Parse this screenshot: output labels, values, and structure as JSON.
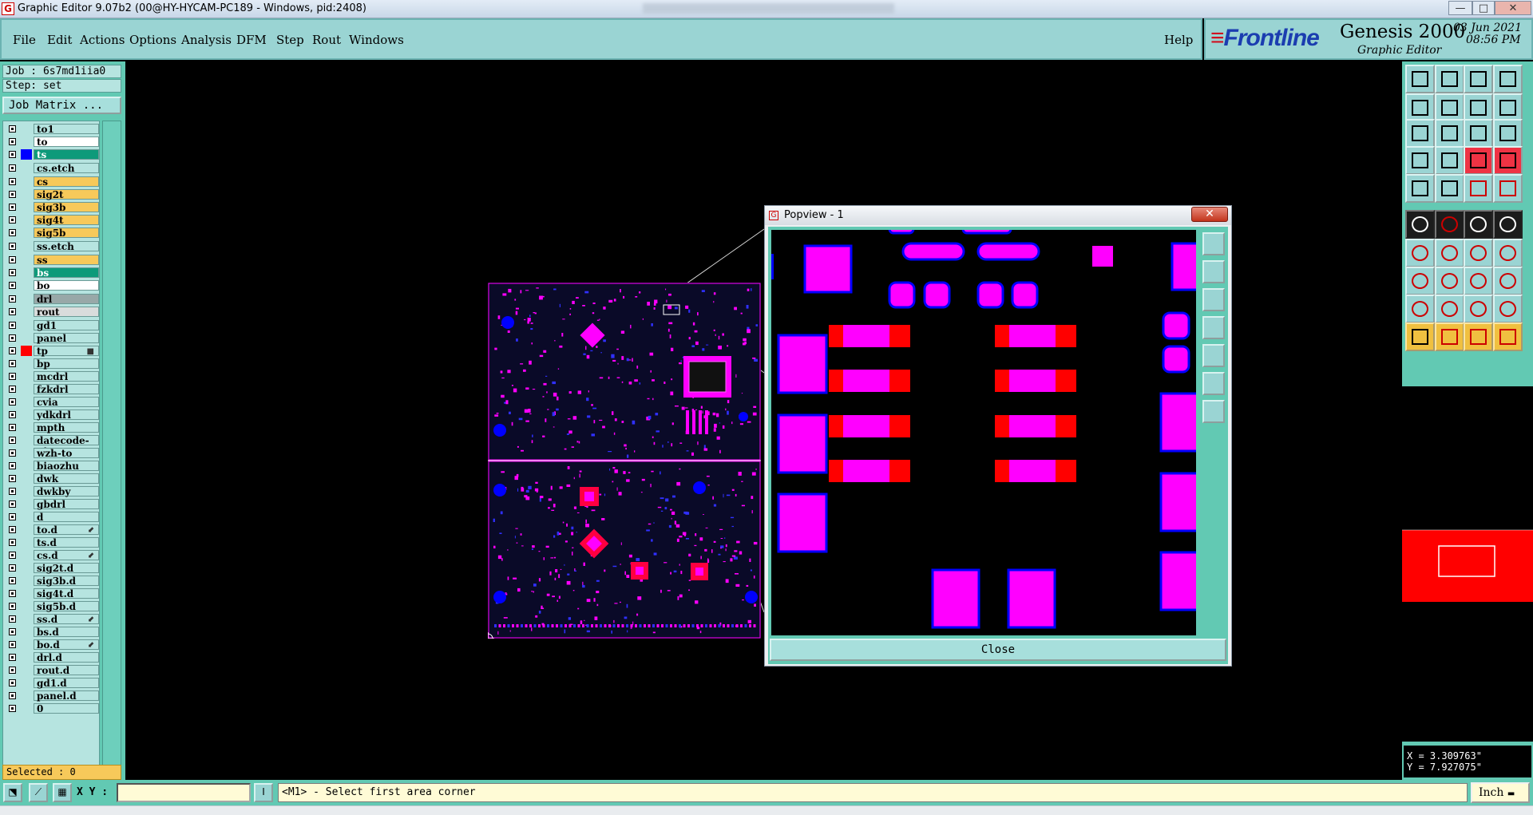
{
  "window": {
    "title": "Graphic Editor 9.07b2 (00@HY-HYCAM-PC189 - Windows, pid:2408)",
    "controls": {
      "minimize": "—",
      "maximize": "□",
      "close": "✕"
    }
  },
  "menu": {
    "items": [
      "File",
      "Edit",
      "Actions",
      "Options",
      "Analysis",
      "DFM",
      "Step",
      "Rout",
      "Windows"
    ],
    "help": "Help"
  },
  "brand": {
    "logo": "Frontline",
    "product": "Genesis 2000",
    "subtitle": "Graphic Editor",
    "date": "03 Jun 2021",
    "time": "08:56 PM"
  },
  "job": {
    "job_line": "Job : 6s7md1iia0",
    "step_line": "Step: set",
    "job_matrix": "Job Matrix ..."
  },
  "layers": [
    {
      "name": "to1",
      "swatch": "",
      "bg": "#b6e4e0"
    },
    {
      "name": "to",
      "swatch": "",
      "bg": "#ffffff"
    },
    {
      "name": "ts",
      "swatch": "#0000ff",
      "bg": "#0d9a7a"
    },
    {
      "name": "cs.etch",
      "swatch": "",
      "bg": "#b6e4e0"
    },
    {
      "name": "cs",
      "swatch": "",
      "bg": "#f7c95a"
    },
    {
      "name": "sig2t",
      "swatch": "",
      "bg": "#f7c95a"
    },
    {
      "name": "sig3b",
      "swatch": "",
      "bg": "#f7c95a"
    },
    {
      "name": "sig4t",
      "swatch": "",
      "bg": "#f7c95a"
    },
    {
      "name": "sig5b",
      "swatch": "",
      "bg": "#f7c95a"
    },
    {
      "name": "ss.etch",
      "swatch": "",
      "bg": "#b6e4e0"
    },
    {
      "name": "ss",
      "swatch": "",
      "bg": "#f7c95a"
    },
    {
      "name": "bs",
      "swatch": "",
      "bg": "#0d9a7a"
    },
    {
      "name": "bo",
      "swatch": "",
      "bg": "#ffffff"
    },
    {
      "name": "drl",
      "swatch": "",
      "bg": "#98a8a8"
    },
    {
      "name": "rout",
      "swatch": "",
      "bg": "#d9dcdc"
    },
    {
      "name": "gd1",
      "swatch": "",
      "bg": "#b6e4e0"
    },
    {
      "name": "panel",
      "swatch": "",
      "bg": "#b6e4e0"
    },
    {
      "name": "tp",
      "swatch": "#ff0000",
      "bg": "#b6e4e0",
      "mark": "■"
    },
    {
      "name": "bp",
      "swatch": "",
      "bg": "#b6e4e0"
    },
    {
      "name": "mcdrl",
      "swatch": "",
      "bg": "#b6e4e0"
    },
    {
      "name": "fzkdrl",
      "swatch": "",
      "bg": "#b6e4e0"
    },
    {
      "name": "cvia",
      "swatch": "",
      "bg": "#b6e4e0"
    },
    {
      "name": "ydkdrl",
      "swatch": "",
      "bg": "#b6e4e0"
    },
    {
      "name": "mpth",
      "swatch": "",
      "bg": "#b6e4e0"
    },
    {
      "name": "datecode-pt",
      "swatch": "",
      "bg": "#b6e4e0"
    },
    {
      "name": "wzh-to",
      "swatch": "",
      "bg": "#b6e4e0"
    },
    {
      "name": "biaozhu",
      "swatch": "",
      "bg": "#b6e4e0"
    },
    {
      "name": "dwk",
      "swatch": "",
      "bg": "#b6e4e0"
    },
    {
      "name": "dwkby",
      "swatch": "",
      "bg": "#b6e4e0"
    },
    {
      "name": "gbdrl",
      "swatch": "",
      "bg": "#b6e4e0"
    },
    {
      "name": "d",
      "swatch": "",
      "bg": "#b6e4e0"
    },
    {
      "name": "to.d",
      "swatch": "",
      "bg": "#b6e4e0",
      "mark": "⬋"
    },
    {
      "name": "ts.d",
      "swatch": "",
      "bg": "#b6e4e0"
    },
    {
      "name": "cs.d",
      "swatch": "",
      "bg": "#b6e4e0",
      "mark": "⬋"
    },
    {
      "name": "sig2t.d",
      "swatch": "",
      "bg": "#b6e4e0"
    },
    {
      "name": "sig3b.d",
      "swatch": "",
      "bg": "#b6e4e0"
    },
    {
      "name": "sig4t.d",
      "swatch": "",
      "bg": "#b6e4e0"
    },
    {
      "name": "sig5b.d",
      "swatch": "",
      "bg": "#b6e4e0"
    },
    {
      "name": "ss.d",
      "swatch": "",
      "bg": "#b6e4e0",
      "mark": "⬋"
    },
    {
      "name": "bs.d",
      "swatch": "",
      "bg": "#b6e4e0"
    },
    {
      "name": "bo.d",
      "swatch": "",
      "bg": "#b6e4e0",
      "mark": "⬋"
    },
    {
      "name": "drl.d",
      "swatch": "",
      "bg": "#b6e4e0"
    },
    {
      "name": "rout.d",
      "swatch": "",
      "bg": "#b6e4e0"
    },
    {
      "name": "gd1.d",
      "swatch": "",
      "bg": "#b6e4e0"
    },
    {
      "name": "panel.d",
      "swatch": "",
      "bg": "#b6e4e0"
    },
    {
      "name": "0",
      "swatch": "",
      "bg": "#b6e4e0"
    }
  ],
  "selected": "Selected : 0",
  "popview": {
    "title": "Popview - 1",
    "close_label": "Close"
  },
  "coords": {
    "x": "X = 3.309763\"",
    "y": "Y = 7.927075\""
  },
  "status": {
    "xy_label": "X Y :",
    "xy_value": "",
    "message": "<M1> - Select first area corner",
    "unit": "Inch"
  },
  "colors": {
    "panel": "#62c9b3",
    "menu": "#9ad4d3",
    "pad": "#ff00ff",
    "layer_blue": "#0000ff",
    "layer_red": "#ff0000"
  }
}
